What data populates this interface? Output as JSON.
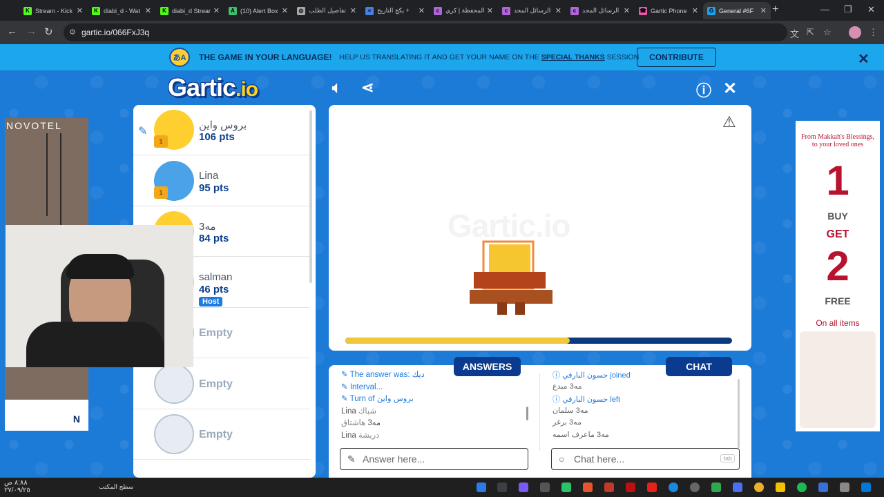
{
  "browser": {
    "tabs": [
      {
        "label": "Stream - Kick",
        "fav_color": "#53fc18",
        "fav_glyph": "K"
      },
      {
        "label": "diabi_d - Wat",
        "fav_color": "#53fc18",
        "fav_glyph": "K"
      },
      {
        "label": "diabi_d Stream",
        "fav_color": "#53fc18",
        "fav_glyph": "K"
      },
      {
        "label": "(10) Alert Box",
        "fav_color": "#3fbf6f",
        "fav_glyph": "A"
      },
      {
        "label": "تفاصيل الطلب",
        "fav_color": "#aaaaaa",
        "fav_glyph": "◎"
      },
      {
        "label": "بكج التاريخ +",
        "fav_color": "#4a7ee0",
        "fav_glyph": "≡"
      },
      {
        "label": "المحفظة | كري",
        "fav_color": "#b066d8",
        "fav_glyph": "c"
      },
      {
        "label": "الرسائل المحد",
        "fav_color": "#b066d8",
        "fav_glyph": "c"
      },
      {
        "label": "الرسائل المحد",
        "fav_color": "#b066d8",
        "fav_glyph": "c"
      },
      {
        "label": "Gartic Phone",
        "fav_color": "#e85aa8",
        "fav_glyph": "☎"
      },
      {
        "label": "General #6F",
        "fav_color": "#1fa0ea",
        "fav_glyph": "G"
      }
    ],
    "url": "gartic.io/066FxJ3q"
  },
  "banner": {
    "globe_label": "あA",
    "headline": "THE GAME IN YOUR LANGUAGE!",
    "sub_prefix": "HELP US TRANSLATING IT AND GET YOUR NAME ON THE",
    "sub_link": "SPECIAL THANKS",
    "sub_suffix": "SESSION",
    "contribute_label": "CONTRIBUTE"
  },
  "logo": {
    "main": "Gartic",
    "suffix": ".io"
  },
  "players": [
    {
      "name": "بروس واين",
      "pts": "106 pts",
      "avatar_color": "#ffcf2f",
      "drawing": true
    },
    {
      "name": "Lina",
      "pts": "95 pts",
      "avatar_color": "#4aa3e8"
    },
    {
      "name": "مه3",
      "pts": "84 pts",
      "avatar_color": "#ffcf2f"
    },
    {
      "name": "salman",
      "pts": "46 pts",
      "host_label": "Host",
      "avatar_color": "#ffcf2f"
    },
    {
      "empty_label": "Empty"
    },
    {
      "empty_label": "Empty"
    },
    {
      "empty_label": "Empty"
    }
  ],
  "ads_left": {
    "brand": "NOVOTEL",
    "bottom": "N"
  },
  "canvas": {
    "watermark": "Gartic.io",
    "timer_fraction": 0.58
  },
  "answers": {
    "tab_label": "ANSWERS",
    "messages": [
      {
        "kind": "sys",
        "text": "The answer was: ديك"
      },
      {
        "kind": "sys",
        "text": "Interval..."
      },
      {
        "kind": "sys",
        "text": "Turn of بروس واين"
      },
      {
        "kind": "ans",
        "user": "Lina",
        "text": "شباك"
      },
      {
        "kind": "ans",
        "user": "مه3",
        "text": "هاشتاق"
      },
      {
        "kind": "ans",
        "user": "Lina",
        "text": "دريشة"
      }
    ],
    "placeholder": "Answer here..."
  },
  "chat": {
    "tab_label": "CHAT",
    "messages": [
      {
        "kind": "sys",
        "text": "حسون البارقي joined"
      },
      {
        "kind": "msg",
        "user": "مه3",
        "text": "مبدع"
      },
      {
        "kind": "sys",
        "text": "حسون البارقي left"
      },
      {
        "kind": "msg",
        "user": "مه3",
        "text": "سلمان"
      },
      {
        "kind": "msg",
        "user": "مه3",
        "text": "برغر"
      },
      {
        "kind": "msg",
        "user": "مه3",
        "text": "ماعرف اسمه"
      }
    ],
    "placeholder": "Chat here...",
    "tab_key": "tab"
  },
  "ad_right": {
    "line1": "From Makkah's Blessings, to your loved ones",
    "n1": "1",
    "buy": "BUY",
    "get": "GET",
    "n2": "2",
    "free": "FREE",
    "on_all": "On all items"
  },
  "taskbar": {
    "desktop_label": "سطح المكتب",
    "time": "٨:٨٨ ص",
    "date": "٢٧/٠٩/٢٥"
  }
}
